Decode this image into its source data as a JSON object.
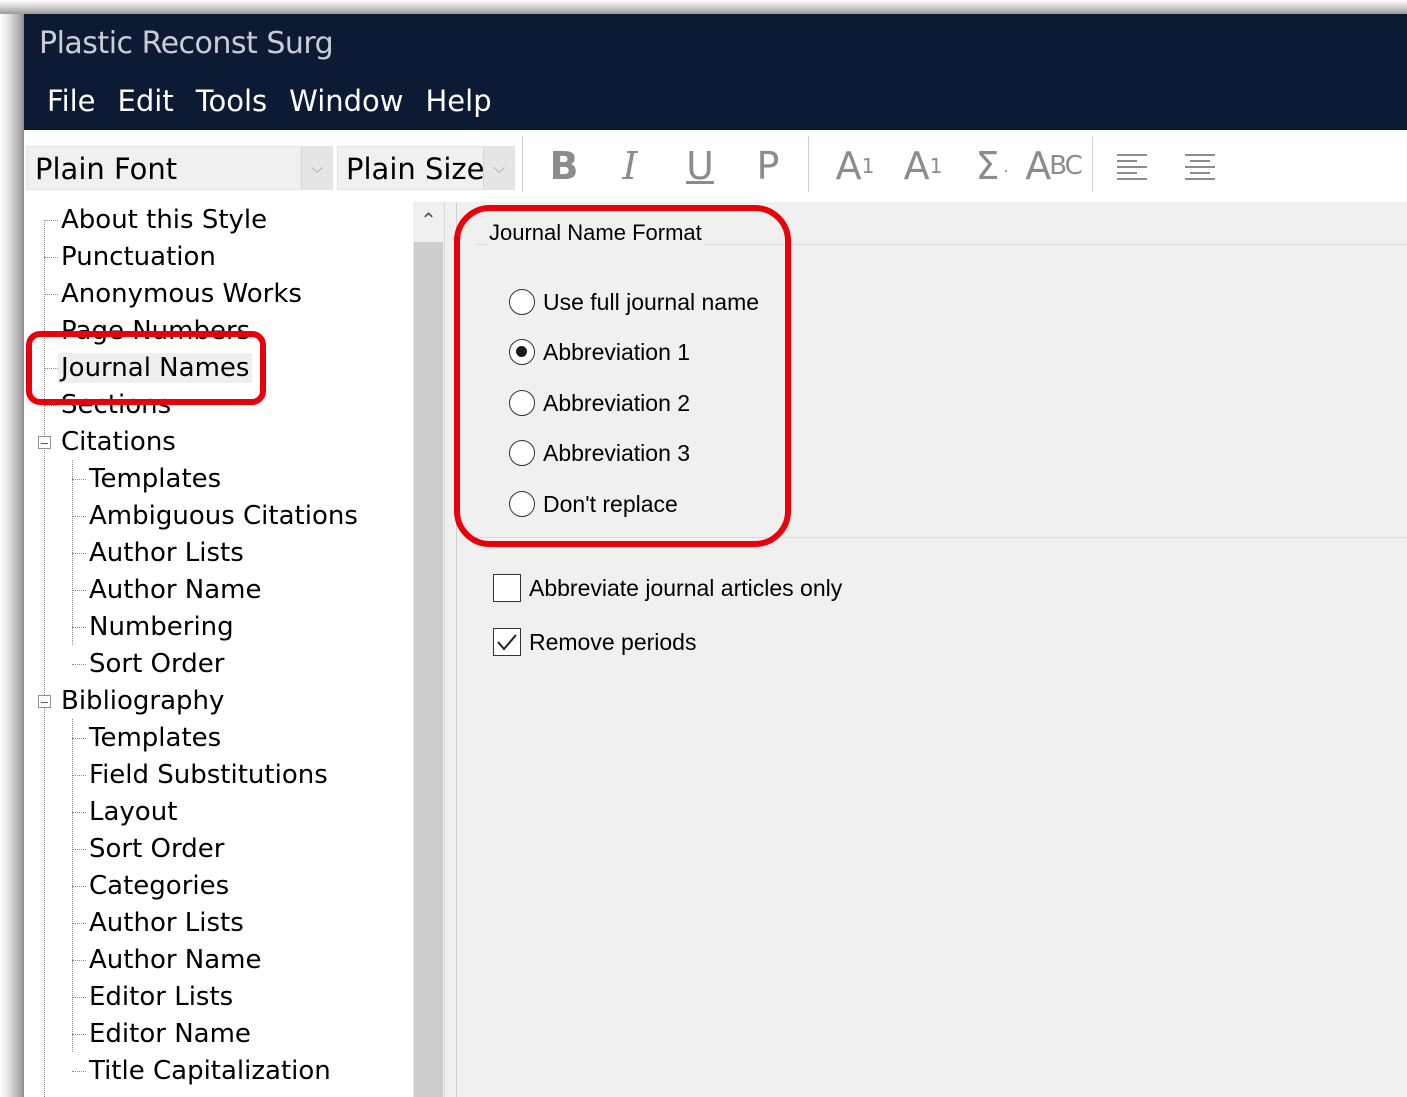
{
  "window": {
    "title": "Plastic Reconst Surg"
  },
  "menu": [
    "File",
    "Edit",
    "Tools",
    "Window",
    "Help"
  ],
  "toolbar": {
    "font_select": "Plain Font",
    "size_select": "Plain Size",
    "bold": "B",
    "italic": "I",
    "underline": "U",
    "plain": "P",
    "superscript_base": "A",
    "superscript_mark": "1",
    "subscript_base": "A",
    "subscript_mark": "1",
    "symbol": "Σ",
    "smallcaps_big": "A",
    "smallcaps_small": "BC"
  },
  "tree": {
    "top_items": [
      "About this Style",
      "Punctuation",
      "Anonymous Works",
      "Page Numbers",
      "Journal Names",
      "Sections"
    ],
    "selected": "Journal Names",
    "citations": {
      "label": "Citations",
      "children": [
        "Templates",
        "Ambiguous Citations",
        "Author Lists",
        "Author Name",
        "Numbering",
        "Sort Order"
      ]
    },
    "bibliography": {
      "label": "Bibliography",
      "children": [
        "Templates",
        "Field Substitutions",
        "Layout",
        "Sort Order",
        "Categories",
        "Author Lists",
        "Author Name",
        "Editor Lists",
        "Editor Name",
        "Title Capitalization"
      ]
    }
  },
  "journal_format": {
    "group_title": "Journal Name Format",
    "options": [
      "Use full journal name",
      "Abbreviation 1",
      "Abbreviation 2",
      "Abbreviation 3",
      "Don't replace"
    ],
    "selected": "Abbreviation 1"
  },
  "checkboxes": [
    {
      "label": "Abbreviate journal articles only",
      "checked": false
    },
    {
      "label": "Remove periods",
      "checked": true
    }
  ],
  "colors": {
    "titlebar": "#0c1a33",
    "annotation": "#e8000b"
  }
}
